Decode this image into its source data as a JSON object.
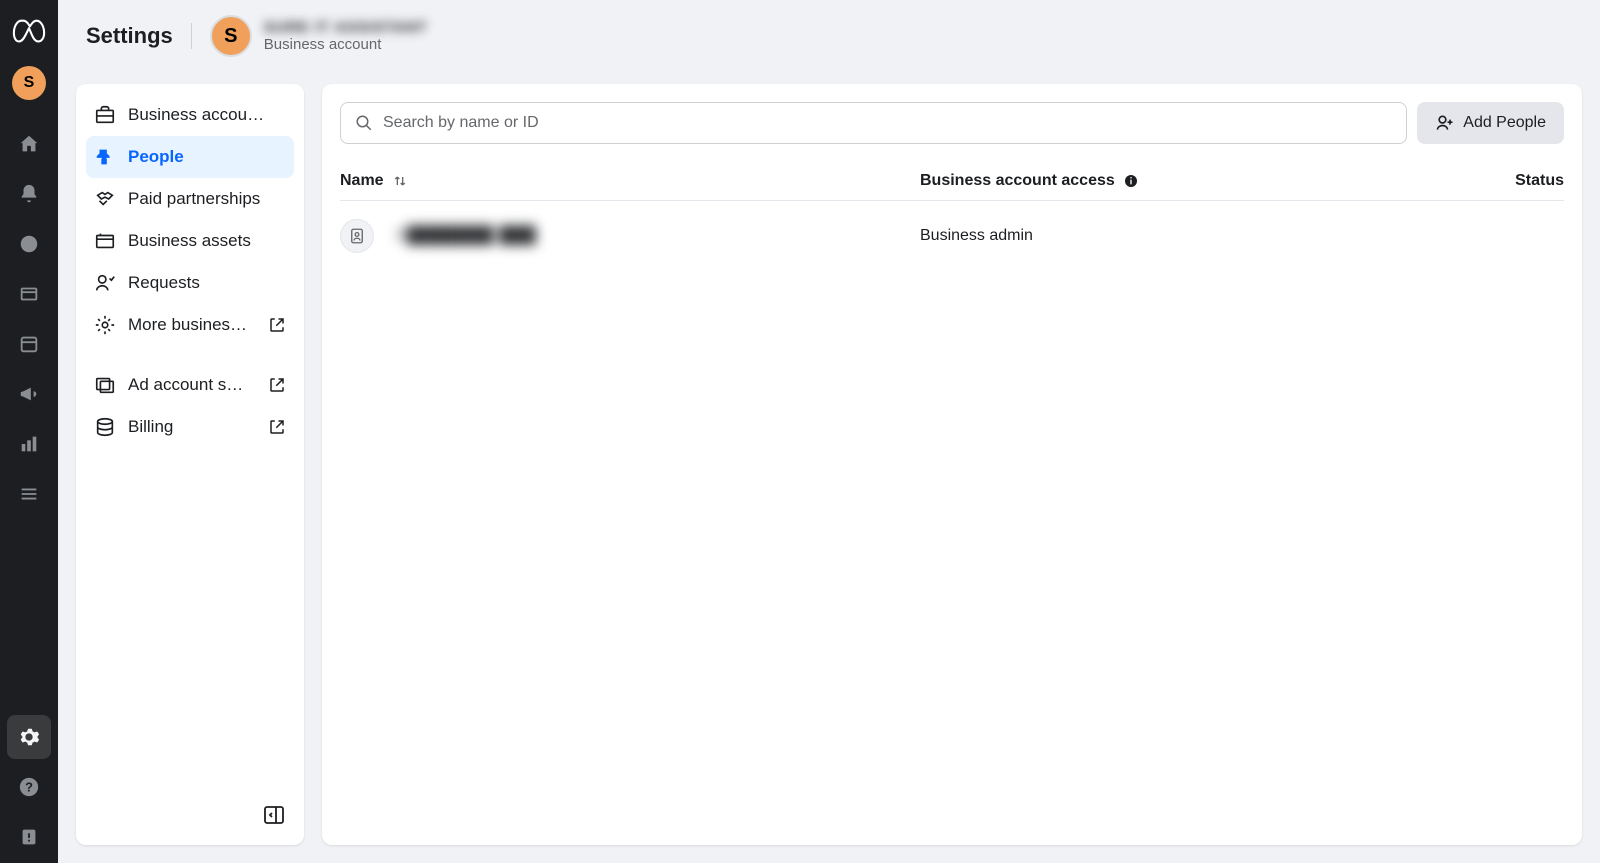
{
  "rail": {
    "avatar_letter": "S"
  },
  "header": {
    "title": "Settings",
    "avatar_letter": "S",
    "account_name": "SURE IT ASSISTANT",
    "account_subtitle": "Business account"
  },
  "sidebar": {
    "items": [
      {
        "id": "business-account",
        "label": "Business accou…",
        "external": false
      },
      {
        "id": "people",
        "label": "People",
        "external": false,
        "active": true
      },
      {
        "id": "paid-partnerships",
        "label": "Paid partnerships",
        "external": false
      },
      {
        "id": "business-assets",
        "label": "Business assets",
        "external": false
      },
      {
        "id": "requests",
        "label": "Requests",
        "external": false
      },
      {
        "id": "more-business",
        "label": "More busines…",
        "external": true
      },
      {
        "id": "ad-account-settings",
        "label": "Ad account s…",
        "external": true
      },
      {
        "id": "billing",
        "label": "Billing",
        "external": true
      }
    ]
  },
  "content": {
    "search_placeholder": "Search by name or ID",
    "add_button_label": "Add People",
    "columns": {
      "name": "Name",
      "access": "Business account access",
      "status": "Status"
    },
    "rows": [
      {
        "name": "S███████ ███",
        "access": "Business admin",
        "status": ""
      }
    ]
  }
}
